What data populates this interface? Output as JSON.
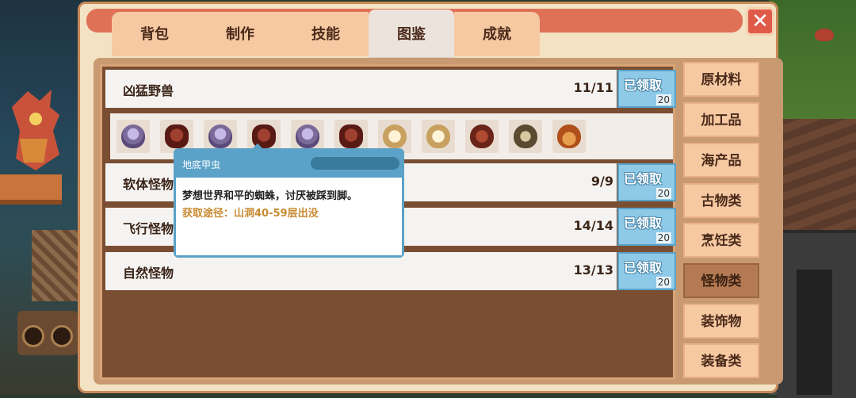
{
  "tabs": [
    {
      "label": "背包",
      "active": false
    },
    {
      "label": "制作",
      "active": false
    },
    {
      "label": "技能",
      "active": false
    },
    {
      "label": "图鉴",
      "active": true
    },
    {
      "label": "成就",
      "active": false
    }
  ],
  "close_label": "✕",
  "groups": [
    {
      "title": "凶猛野兽",
      "count": "11/11",
      "badge": "已领取",
      "reward": "20"
    },
    {
      "title": "软体怪物",
      "count": "9/9",
      "badge": "已领取",
      "reward": "20"
    },
    {
      "title": "飞行怪物",
      "count": "14/14",
      "badge": "已领取",
      "reward": "20"
    },
    {
      "title": "自然怪物",
      "count": "13/13",
      "badge": "已领取",
      "reward": "20"
    }
  ],
  "monster_icons": [
    "jelly-icon",
    "beetle-icon",
    "jelly-icon",
    "beetle-icon",
    "jelly-icon",
    "beetle-icon",
    "mummy-icon",
    "mummy-icon",
    "boar-icon",
    "sand-creature-icon",
    "crab-icon"
  ],
  "tooltip": {
    "name": "地底甲虫",
    "description": "梦想世界和平的蜘蛛，讨厌被踩到脚。",
    "source": "获取途径：山洞40-59层出没"
  },
  "categories": [
    {
      "label": "原材料",
      "active": false
    },
    {
      "label": "加工品",
      "active": false
    },
    {
      "label": "海产品",
      "active": false
    },
    {
      "label": "古物类",
      "active": false
    },
    {
      "label": "烹饪类",
      "active": false
    },
    {
      "label": "怪物类",
      "active": true
    },
    {
      "label": "装饰物",
      "active": false
    },
    {
      "label": "装备类",
      "active": false
    }
  ]
}
